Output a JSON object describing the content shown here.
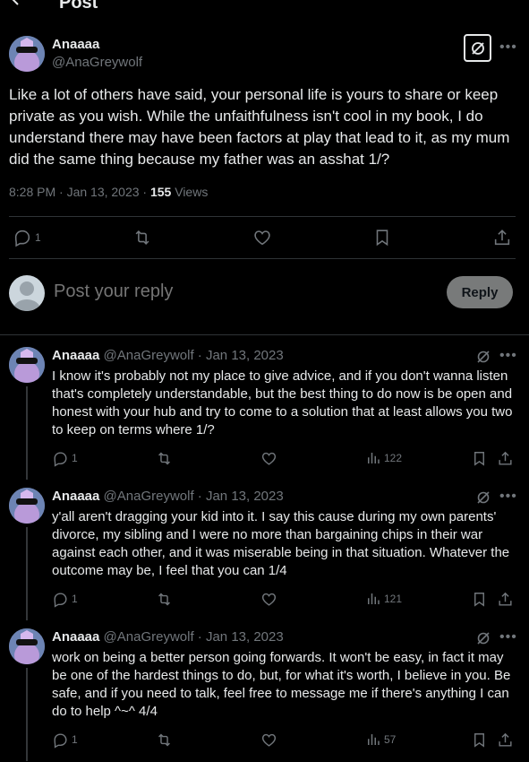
{
  "header": {
    "title": "Post"
  },
  "main_post": {
    "name": "Anaaaa",
    "handle": "@AnaGreywolf",
    "text": "Like a lot of others have said, your personal life is yours to share or keep private as you wish. While the unfaithfulness isn't cool in my book, I do understand there may have been factors at play that lead to it, as my mum did the same thing because my father was an asshat 1/?",
    "time": "8:28 PM · Jan 13, 2023 · ",
    "views_count": "155",
    "views_label": " Views",
    "reply_count": "1"
  },
  "composer": {
    "placeholder": "Post your reply",
    "button": "Reply"
  },
  "replies": [
    {
      "name": "Anaaaa",
      "meta": " @AnaGreywolf · Jan 13, 2023",
      "text": "I know it's probably not my place to give advice, and if you don't wanna listen that's completely understandable, but the best thing to do now is be open and honest with your hub and try to come to a solution that at least allows you two to keep on terms where 1/?",
      "reply_count": "1",
      "views": "122"
    },
    {
      "name": "Anaaaa",
      "meta": " @AnaGreywolf · Jan 13, 2023",
      "text": "y'all aren't dragging your kid into it. I say this cause during my own parents' divorce, my sibling and I were no more than bargaining chips in their war against each other, and it was miserable being in that situation. Whatever the outcome may be, I feel that you can 1/4",
      "reply_count": "1",
      "views": "121"
    },
    {
      "name": "Anaaaa",
      "meta": " @AnaGreywolf · Jan 13, 2023",
      "text": "work on being a better person going forwards. It won't be easy, in fact it may be one of the hardest things to do, but, for what it's worth, I believe in you. Be safe, and if you need to talk, feel free to message me if there's anything I can do to help ^~^ 4/4",
      "reply_count": "1",
      "views": "57"
    }
  ],
  "icons": {
    "back": "arrow-left-icon",
    "more": "more-horizontal-icon",
    "grok": "grok-icon",
    "reply": "reply-bubble-icon",
    "retweet": "repost-icon",
    "like": "heart-icon",
    "bookmark": "bookmark-icon",
    "share": "share-icon",
    "views": "bar-chart-icon"
  },
  "colors": {
    "background": "#000000",
    "text": "#e7e9ea",
    "muted": "#71767b",
    "divider": "#2f3336",
    "reply_button": "#787a7a"
  }
}
